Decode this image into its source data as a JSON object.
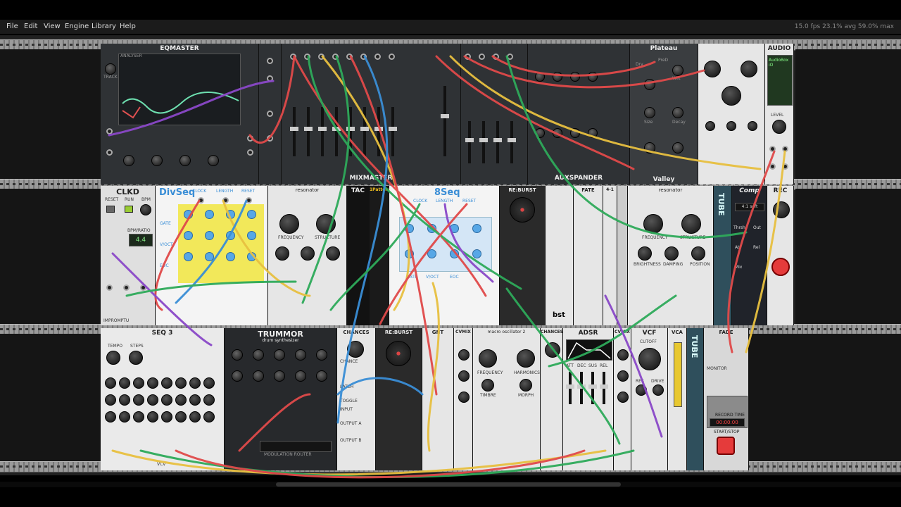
{
  "menu": {
    "file": "File",
    "edit": "Edit",
    "view": "View",
    "engine": "Engine",
    "library": "Library",
    "help": "Help",
    "status": "15.0 fps  23.1% avg  59.0% max"
  },
  "modules": {
    "eqmaster": "EQMASTER",
    "mixmaster": "MIXMASTER",
    "auxspander": "AUXSPANDER",
    "plateau": "Plateau",
    "valley": "Valley",
    "audio": "AUDIO",
    "clkd": "CLKD",
    "divseq": "DivSeq",
    "resonator_a": "resonator",
    "tac": "TAC",
    "pattern": "1Pattern",
    "eightseq": "8Seq",
    "reburst_a": "RE:BURST",
    "fate": "FATE",
    "fourone": "4-1",
    "resonator_b": "resonator",
    "tube_a": "TUBE",
    "comp": "Comp",
    "rec": "REC",
    "seq3": "SEQ 3",
    "trummor": "TRUMMOR",
    "trummor_sub": "drum synthesizer",
    "chances_a": "CHANCES",
    "reburst_b": "RE:BURST",
    "gnt": "GNT",
    "cvmix_a": "CVMIX",
    "macro": "macro oscillator 2",
    "chances_b": "CHANCES",
    "adsr": "ADSR",
    "cvmix_b": "CVMIX",
    "vcf": "VCF",
    "vca": "VCA",
    "tube_b": "TUBE",
    "fade": "FADE",
    "monitor": "MONITOR",
    "record_time": "RECORD TIME",
    "start_stop": "START/STOP",
    "impromptu": "IMPROMPTU",
    "vcv": "VCV",
    "bst": "bst"
  },
  "labels": {
    "divseq_clock": "CLOCK",
    "divseq_length": "LENGTH",
    "divseq_reset": "RESET",
    "divseq_gate": "GATE",
    "divseq_voct": "V/OCT",
    "divseq_eoc": "EOC",
    "eightseq_clock": "CLOCK",
    "eightseq_length": "LENGTH",
    "eightseq_reset": "RESET",
    "eightseq_gate": "GATE",
    "eightseq_voct": "V/OCT",
    "eightseq_eoc": "EOC",
    "clkd_reset": "RESET",
    "clkd_run": "RUN",
    "clkd_bpm": "BPM",
    "clkd_bpmratio": "BPM/RATIO",
    "clkd_display": "4.4",
    "res_frequency": "FREQUENCY",
    "res_structure": "STRUCTURE",
    "res_brightness": "BRIGHTNESS",
    "res_damping": "DAMPING",
    "res_position": "POSITION",
    "seq_tempo": "TEMPO",
    "seq_steps": "STEPS",
    "adsr_att": "ATT",
    "adsr_dec": "DEC",
    "adsr_sus": "SUS",
    "adsr_rel": "REL",
    "vcf_cutoff": "CUTOFF",
    "vcf_res": "RES",
    "vcf_drive": "DRIVE",
    "comp_ratio": "4:1 soft",
    "comp_thrsh": "Thrsh",
    "comp_out": "Out",
    "comp_att": "Att",
    "comp_rel": "Rel",
    "comp_mix": "Mix",
    "audio_device": "AudioBox iO",
    "audio_level": "LEVEL",
    "rec_timer": "00:00:00",
    "macro_frequency": "FREQUENCY",
    "macro_harmonics": "HARMONICS",
    "macro_timbre": "TIMBRE",
    "macro_morph": "MORPH",
    "eq_track": "TRACK",
    "eq_analyser": "ANALYSER",
    "plateau_dry": "Dry",
    "plateau_wet": "Wet",
    "plateau_predelay": "PreD",
    "plateau_decay": "Decay",
    "plateau_size": "Size",
    "chances_chance": "CHANCE",
    "chances_latch": "LATCH",
    "chances_toggle": "TOGGLE",
    "chances_input": "INPUT",
    "chances_output_a": "OUTPUT A",
    "chances_output_b": "OUTPUT B",
    "trummor_modrouter": "MODULATION ROUTER"
  }
}
